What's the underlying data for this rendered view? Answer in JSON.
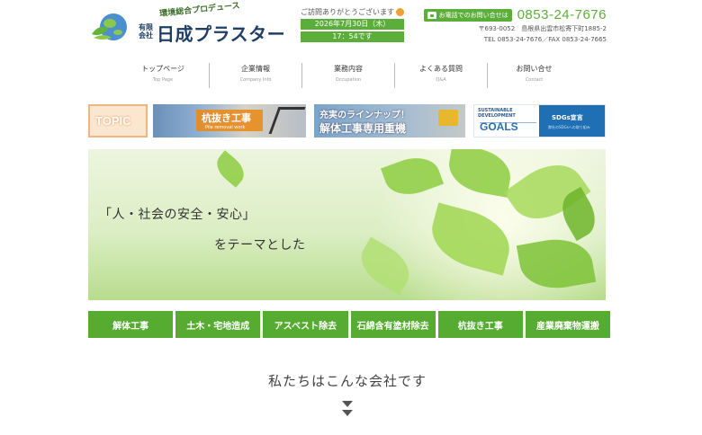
{
  "header": {
    "tagline": "環境総合プロデュース",
    "company_kind": "有限会社",
    "company_name": "日成プラスター",
    "visit_message": "ご訪問ありがとうございます",
    "visit_date": "2026年7月30日（木）",
    "visit_time": "17：54です",
    "phone_label": "お電話でのお問い合せは",
    "phone_number": "0853-24-7676",
    "address": "〒693-0052　島根県出雲市松寄下町1885-2",
    "tel_fax": "TEL 0853-24-7676／FAX 0853-24-7665"
  },
  "nav": [
    {
      "jp": "トップページ",
      "en": "Top Page"
    },
    {
      "jp": "企業情報",
      "en": "Company Info"
    },
    {
      "jp": "業務内容",
      "en": "Occupation"
    },
    {
      "jp": "よくある質問",
      "en": "Q&A"
    },
    {
      "jp": "お問い合せ",
      "en": "Contact"
    }
  ],
  "banners": {
    "topic": "TOPIC",
    "pile_title": "杭抜き工事",
    "pile_sub": "Pile removal work",
    "lineup_line1": "充実のラインナップ！",
    "lineup_line2": "解体工事専用重機",
    "sdgs_title": "SUSTAINABLE\nDEVELOPMENT",
    "sdgs_goals": "GOALS",
    "sdgs_declaration": "SDGs宣言",
    "sdgs_sub": "弊社のSDGsへの取り組み"
  },
  "hero": {
    "line1": "「人・社会の安全・安心」",
    "line2": "をテーマとした"
  },
  "services": [
    "解体工事",
    "土木・宅地造成",
    "アスベスト除去",
    "石綿含有塗材除去",
    "杭抜き工事",
    "産業廃棄物運搬"
  ],
  "company_heading": "私たちはこんな会社です",
  "colors": {
    "accent_green": "#56ab31",
    "navy": "#1f3f66",
    "sdgs_blue": "#1e6fb3"
  }
}
